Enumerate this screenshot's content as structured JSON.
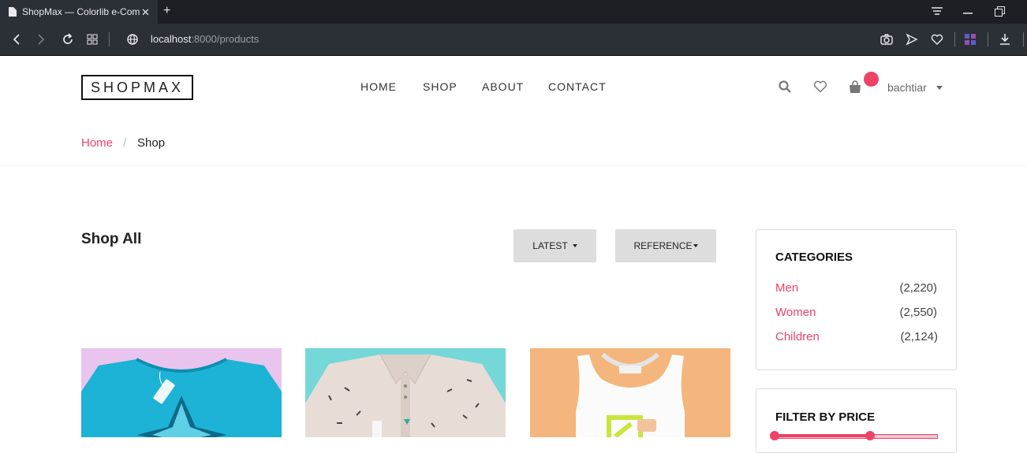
{
  "browser": {
    "tab_title": "ShopMax — Colorlib e-Commerce",
    "url_host": "localhost",
    "url_rest": ":8000/products",
    "close_glyph": "✕",
    "newtab_glyph": "+"
  },
  "site": {
    "logo": "SHOPMAX",
    "nav": [
      "HOME",
      "SHOP",
      "ABOUT",
      "CONTACT"
    ],
    "user": "bachtiar"
  },
  "breadcrumb": {
    "home": "Home",
    "sep": "/",
    "current": "Shop"
  },
  "shop": {
    "heading": "Shop All",
    "latest_btn": "LATEST",
    "reference_btn": "REFERENCE"
  },
  "sidebar": {
    "categories_title": "CATEGORIES",
    "categories": [
      {
        "name": "Men",
        "count": "(2,220)"
      },
      {
        "name": "Women",
        "count": "(2,550)"
      },
      {
        "name": "Children",
        "count": "(2,124)"
      }
    ],
    "filter_title": "FILTER BY PRICE"
  },
  "colors": {
    "accent": "#ee4266",
    "chrome_dark": "#1c1f24",
    "chrome": "#2b2f36"
  },
  "icons": {
    "header": [
      "search-icon",
      "heart-icon",
      "shopping-bag-icon"
    ],
    "browser": [
      "back-icon",
      "forward-icon",
      "reload-icon",
      "grid-icon",
      "globe-icon",
      "camera-icon",
      "send-icon",
      "heart-icon",
      "download-icon"
    ]
  }
}
